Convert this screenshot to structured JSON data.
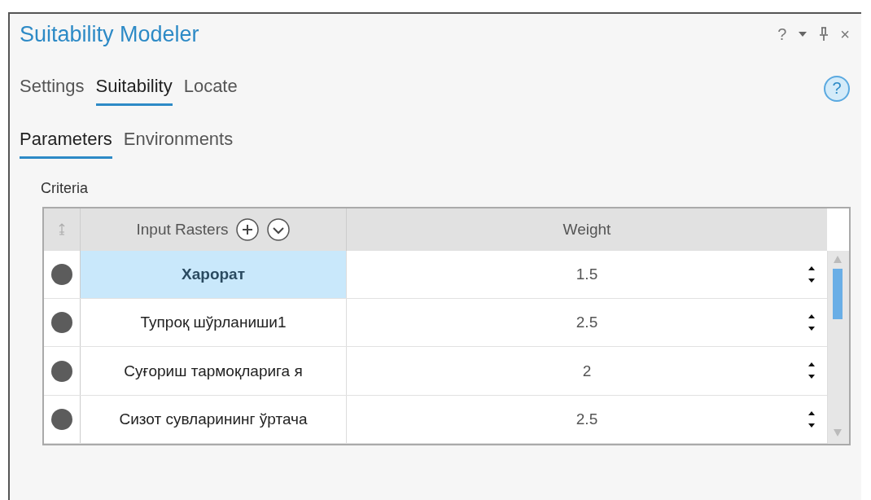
{
  "window": {
    "title": "Suitability Modeler",
    "controls": [
      "?",
      "×"
    ]
  },
  "tabs": [
    {
      "label": "Settings",
      "selected": false
    },
    {
      "label": "Suitability",
      "selected": true
    },
    {
      "label": "Locate",
      "selected": false
    }
  ],
  "help": "?",
  "subtabs": [
    {
      "label": "Parameters",
      "selected": true
    },
    {
      "label": "Environments",
      "selected": false
    }
  ],
  "criteria": {
    "label": "Criteria",
    "columns": [
      "Input Rasters",
      "Weight"
    ],
    "rows": [
      {
        "name": "Харорат",
        "weight": "1.5",
        "selected": true
      },
      {
        "name": "Тупроқ шўрланиши1",
        "weight": "2.5",
        "selected": false
      },
      {
        "name": "Суғориш тармоқларига я",
        "weight": "2",
        "selected": false
      },
      {
        "name": "Сизот сувларининг ўртача",
        "weight": "2.5",
        "selected": false
      }
    ]
  }
}
